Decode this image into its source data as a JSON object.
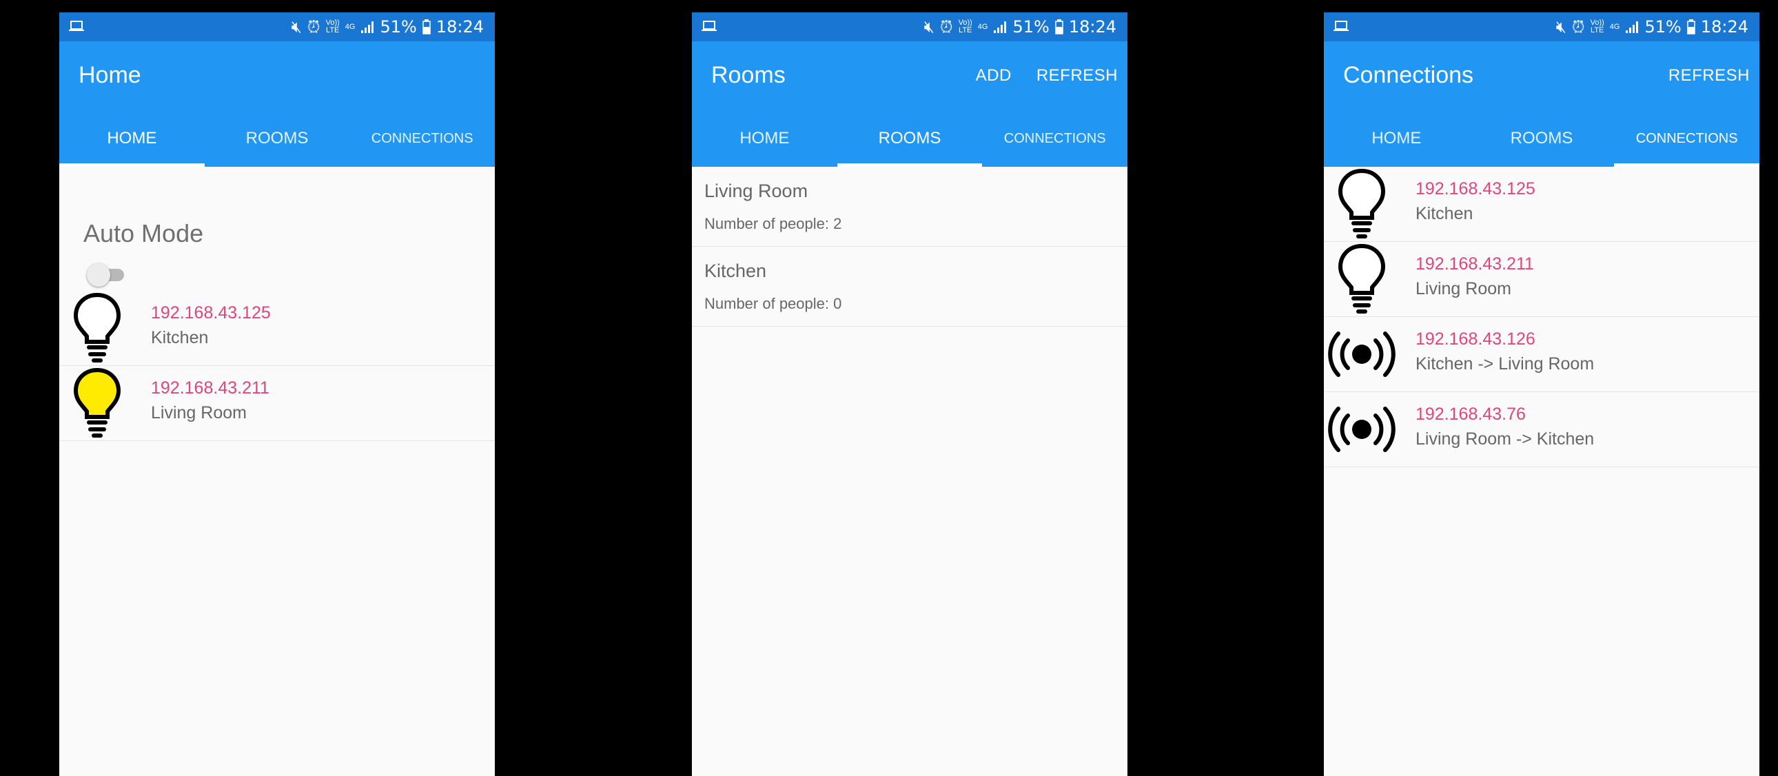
{
  "status": {
    "battery": "51%",
    "time": "18:24",
    "volte_top": "Vo))",
    "volte_bottom": "LTE",
    "net": "4G"
  },
  "screens": [
    {
      "title": "Home",
      "tabs": [
        "HOME",
        "ROOMS",
        "CONNECTIONS"
      ],
      "active_tab": 0,
      "auto_mode_label": "Auto Mode",
      "auto_mode_on": false,
      "devices": [
        {
          "ip": "192.168.43.125",
          "room": "Kitchen",
          "icon": "bulb-off-icon"
        },
        {
          "ip": "192.168.43.211",
          "room": "Living Room",
          "icon": "bulb-on-icon"
        }
      ]
    },
    {
      "title": "Rooms",
      "actions": [
        "ADD",
        "REFRESH"
      ],
      "tabs": [
        "HOME",
        "ROOMS",
        "CONNECTIONS"
      ],
      "active_tab": 1,
      "rooms": [
        {
          "name": "Living Room",
          "people": "Number of people: 2"
        },
        {
          "name": "Kitchen",
          "people": "Number of people: 0"
        }
      ]
    },
    {
      "title": "Connections",
      "actions": [
        "REFRESH"
      ],
      "tabs": [
        "HOME",
        "ROOMS",
        "CONNECTIONS"
      ],
      "active_tab": 2,
      "connections": [
        {
          "ip": "192.168.43.125",
          "label": "Kitchen",
          "icon": "bulb-off-icon"
        },
        {
          "ip": "192.168.43.211",
          "label": "Living Room",
          "icon": "bulb-off-icon"
        },
        {
          "ip": "192.168.43.126",
          "label": "Kitchen -> Living Room",
          "icon": "sensor-icon"
        },
        {
          "ip": "192.168.43.76",
          "label": "Living Room -> Kitchen",
          "icon": "sensor-icon"
        }
      ]
    }
  ],
  "colors": {
    "primary": "#2196f3",
    "status_bar": "#1976d2",
    "accent": "#e0457b",
    "bulb_on": "#ffeb00"
  }
}
